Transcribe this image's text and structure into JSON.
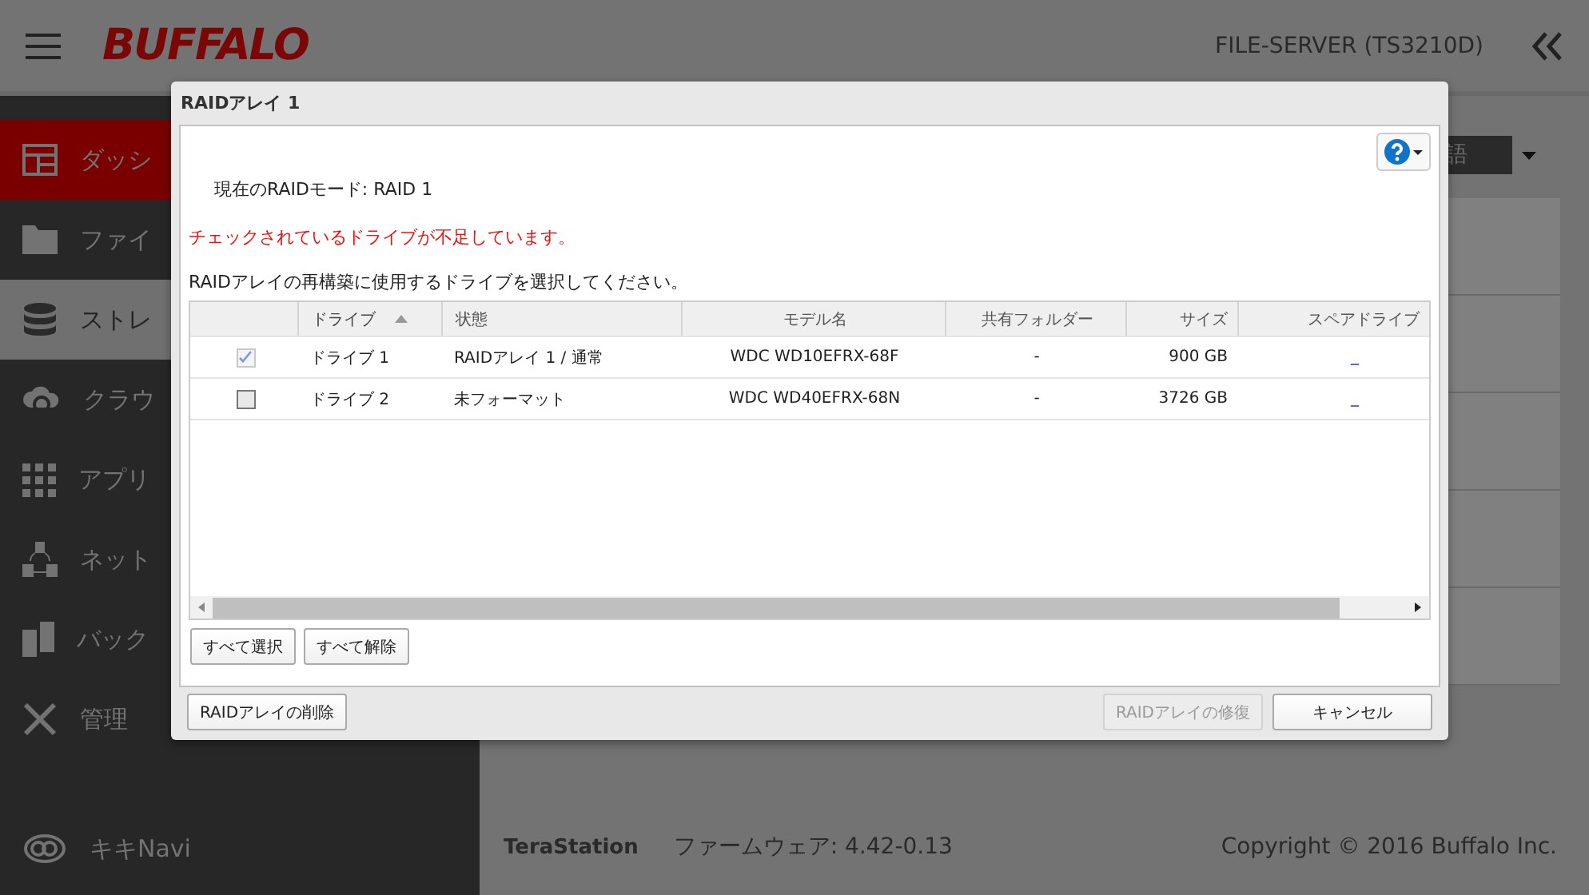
{
  "header": {
    "logo": "BUFFALO",
    "device": "FILE-SERVER (TS3210D)"
  },
  "sidebar": {
    "items": [
      {
        "label": "ダッシ",
        "selected": true,
        "highlighted": false
      },
      {
        "label": "ファイ",
        "selected": false,
        "highlighted": false
      },
      {
        "label": "ストレ",
        "selected": false,
        "highlighted": true
      },
      {
        "label": "クラウ",
        "selected": false,
        "highlighted": false
      },
      {
        "label": "アプリ",
        "selected": false,
        "highlighted": false
      },
      {
        "label": "ネット",
        "selected": false,
        "highlighted": false
      },
      {
        "label": "バック",
        "selected": false,
        "highlighted": false
      },
      {
        "label": "管理",
        "selected": false,
        "highlighted": false
      }
    ],
    "footer_item": {
      "label": "キキNavi"
    }
  },
  "language_select": {
    "value": "語"
  },
  "footer": {
    "product": "TeraStation",
    "firmware": "ファームウェア: 4.42-0.13",
    "copyright": "Copyright © 2016 Buffalo Inc."
  },
  "dialog": {
    "title": "RAIDアレイ 1",
    "mode": "現在のRAIDモード: RAID 1",
    "error": "チェックされているドライブが不足しています。",
    "instruction": "RAIDアレイの再構築に使用するドライブを選択してください。",
    "table": {
      "columns": [
        {
          "label": "ドライブ",
          "sorted": true
        },
        {
          "label": "状態",
          "sorted": false
        },
        {
          "label": "モデル名",
          "sorted": false
        },
        {
          "label": "共有フォルダー",
          "sorted": false
        },
        {
          "label": "サイズ",
          "sorted": false
        },
        {
          "label": "スペアドライブ",
          "sorted": false
        }
      ],
      "rows": [
        {
          "checked": true,
          "disabled": true,
          "drive": "ドライブ 1",
          "status": "RAIDアレイ 1 / 通常",
          "model": "WDC WD10EFRX-68F",
          "share": "-",
          "size": "900 GB",
          "spare": "_"
        },
        {
          "checked": false,
          "disabled": false,
          "drive": "ドライブ 2",
          "status": "未フォーマット",
          "model": "WDC WD40EFRX-68N",
          "share": "-",
          "size": "3726 GB",
          "spare": "_"
        }
      ]
    },
    "table_buttons": [
      {
        "label": "すべて選択"
      },
      {
        "label": "すべて解除"
      }
    ],
    "left_buttons": [
      {
        "label": "RAIDアレイの削除",
        "disabled": false
      }
    ],
    "right_buttons": [
      {
        "label": "RAIDアレイの修復",
        "disabled": true
      },
      {
        "label": "キャンセル",
        "disabled": false
      }
    ]
  }
}
